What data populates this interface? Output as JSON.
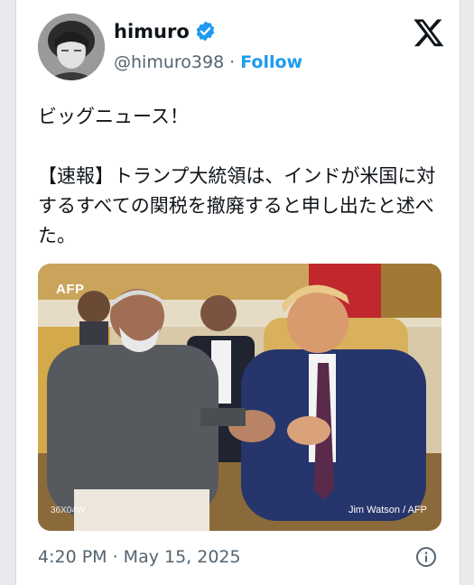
{
  "author": {
    "display_name": "himuro",
    "handle": "@himuro398",
    "follow_label": "Follow",
    "separator": "·"
  },
  "tweet": {
    "text": "ビッグニュース！\n\n【速報】トランプ大統領は、インドが米国に対するすべての関税を撤廃すると申し出たと述べた。",
    "media": {
      "watermark": "AFP",
      "photo_credit": "Jim Watson / AFP",
      "photo_id": "36X04W"
    },
    "timestamp": "4:20 PM · May 15, 2025"
  },
  "icons": [
    "verified-badge-icon",
    "x-logo-icon",
    "info-icon"
  ],
  "colors": {
    "accent": "#1d9bf0",
    "text": "#0f1419",
    "secondary_text": "#536471"
  }
}
